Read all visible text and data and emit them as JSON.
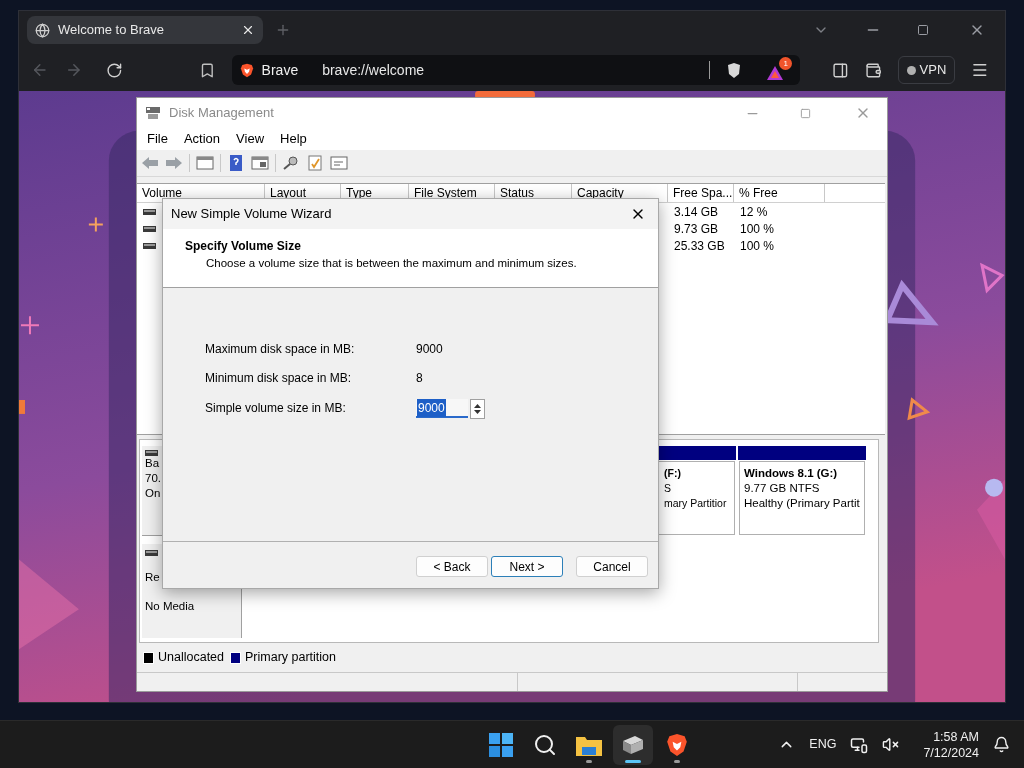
{
  "browser": {
    "tabs": [
      {
        "title": "Welcome to Brave",
        "selected": true
      }
    ],
    "address": {
      "site_label": "Brave",
      "url": "brave://welcome"
    },
    "rewards_badge": "1",
    "vpn_label": "VPN"
  },
  "disk_management": {
    "title": "Disk Management",
    "menu": [
      "File",
      "Action",
      "View",
      "Help"
    ],
    "columns": [
      "Volume",
      "Layout",
      "Type",
      "File System",
      "Status",
      "Capacity",
      "Free Spa...",
      "% Free"
    ],
    "rows": [
      {
        "free_space": "3.14 GB",
        "percent_free": "12 %"
      },
      {
        "free_space": "9.73 GB",
        "percent_free": "100 %"
      },
      {
        "free_space": "25.33 GB",
        "percent_free": "100 %"
      }
    ],
    "disks": [
      {
        "kind": "basic",
        "label_lines": [
          "Ba",
          "70.",
          "On"
        ],
        "partitions": [
          {
            "title": "(F:)",
            "lines": [
              "S",
              "mary Partitior"
            ],
            "color": "#000080"
          },
          {
            "title": "Windows 8.1  (G:)",
            "lines": [
              "9.77 GB NTFS",
              "Healthy (Primary Partit"
            ],
            "color": "#000080"
          }
        ]
      },
      {
        "kind": "removable",
        "label_lines": [
          "Re",
          "No Media"
        ]
      }
    ],
    "legend": [
      {
        "label": "Unallocated",
        "color": "#000000"
      },
      {
        "label": "Primary partition",
        "color": "#000080"
      }
    ]
  },
  "wizard": {
    "title": "New Simple Volume Wizard",
    "heading": "Specify Volume Size",
    "description": "Choose a volume size that is between the maximum and minimum sizes.",
    "info": [
      {
        "label": "Maximum disk space in MB:",
        "value": "9000"
      },
      {
        "label": "Minimum disk space in MB:",
        "value": "8"
      }
    ],
    "size_field": {
      "label": "Simple volume size in MB:",
      "value": "9000",
      "text_selected": true
    },
    "buttons": [
      {
        "label": "< Back",
        "default": false
      },
      {
        "label": "Next >",
        "default": true
      },
      {
        "label": "Cancel",
        "default": false
      }
    ]
  },
  "taskbar": {
    "apps": [
      {
        "kind": "start",
        "running": false,
        "selected": false
      },
      {
        "kind": "search",
        "running": false,
        "selected": false
      },
      {
        "kind": "explorer",
        "running": true,
        "selected": false
      },
      {
        "kind": "diskmgmt",
        "running": true,
        "selected": true
      },
      {
        "kind": "brave",
        "running": true,
        "selected": false
      }
    ],
    "language": "ENG",
    "time": "1:58 AM",
    "date": "7/12/2024"
  }
}
